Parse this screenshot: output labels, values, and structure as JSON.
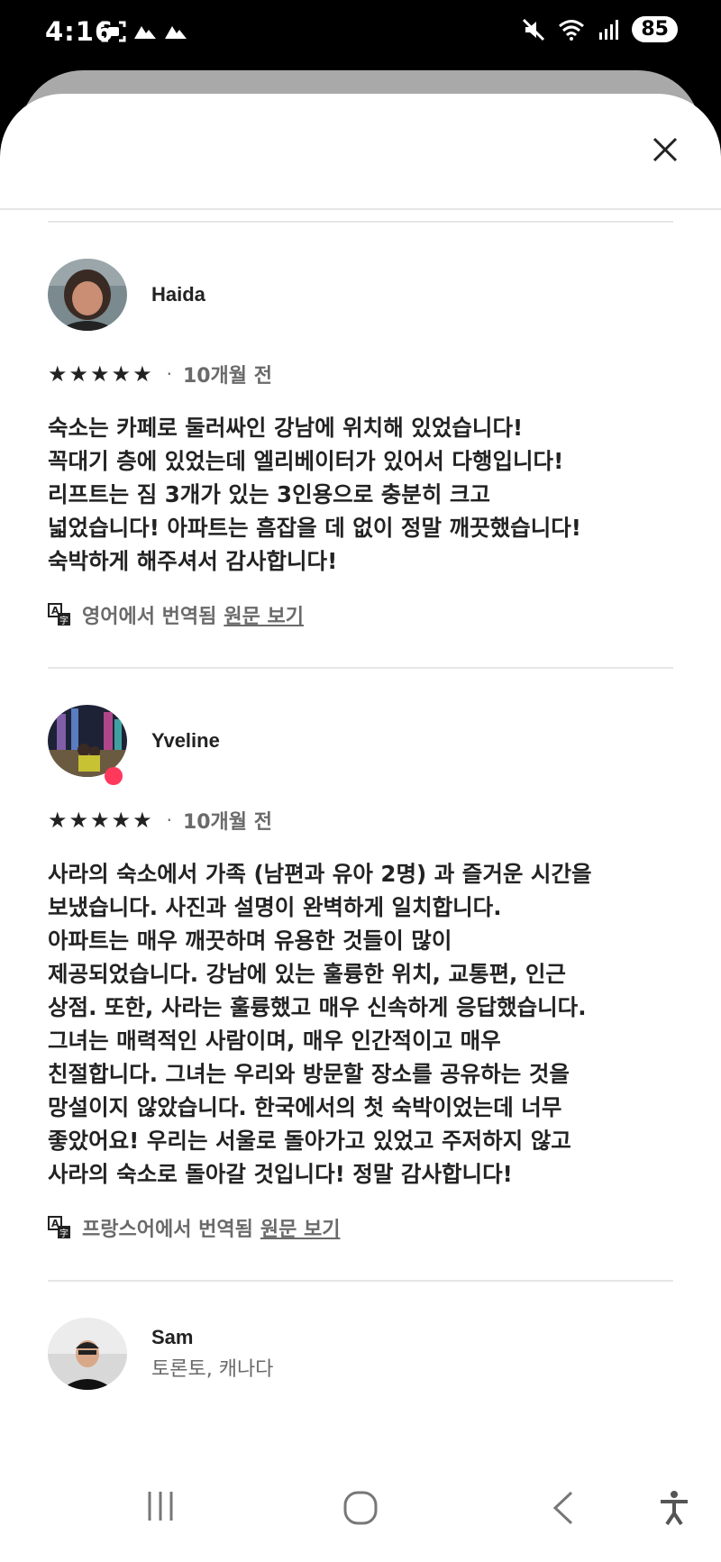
{
  "status": {
    "time": "4:16",
    "battery": "85"
  },
  "reviews": [
    {
      "name": "Haida",
      "stars": 5,
      "date": "10개월 전",
      "text": "숙소는 카페로 둘러싸인 강남에 위치해 있었습니다!\n꼭대기 층에 있었는데 엘리베이터가 있어서 다행입니다!\n리프트는 짐 3개가 있는 3인용으로 충분히 크고\n넓었습니다! 아파트는 흠잡을 데 없이 정말 깨끗했습니다!\n숙박하게 해주셔서 감사합니다!",
      "translated_from": "영어에서 번역됨",
      "show_original": "원문 보기"
    },
    {
      "name": "Yveline",
      "stars": 5,
      "date": "10개월 전",
      "text": "사라의 숙소에서 가족 (남편과 유아 2명) 과 즐거운 시간을\n보냈습니다. 사진과 설명이 완벽하게 일치합니다.\n아파트는 매우 깨끗하며 유용한 것들이 많이\n제공되었습니다. 강남에 있는 훌륭한 위치, 교통편, 인근\n상점. 또한, 사라는 훌륭했고 매우 신속하게 응답했습니다.\n그녀는 매력적인 사람이며, 매우 인간적이고 매우\n친절합니다. 그녀는 우리와 방문할 장소를 공유하는 것을\n망설이지 않았습니다. 한국에서의 첫 숙박이었는데 너무\n좋았어요! 우리는 서울로 돌아가고 있었고 주저하지 않고\n사라의 숙소로 돌아갈 것입니다! 정말 감사합니다!",
      "translated_from": "프랑스어에서 번역됨",
      "show_original": "원문 보기"
    },
    {
      "name": "Sam",
      "location": "토론토, 캐나다"
    }
  ],
  "icons": {
    "close": "close-icon",
    "star": "star-icon",
    "translate": "translate-icon",
    "recents": "recents-icon",
    "home": "home-icon",
    "back": "back-icon",
    "accessibility": "accessibility-icon"
  },
  "colors": {
    "badge": "#ff385c"
  }
}
